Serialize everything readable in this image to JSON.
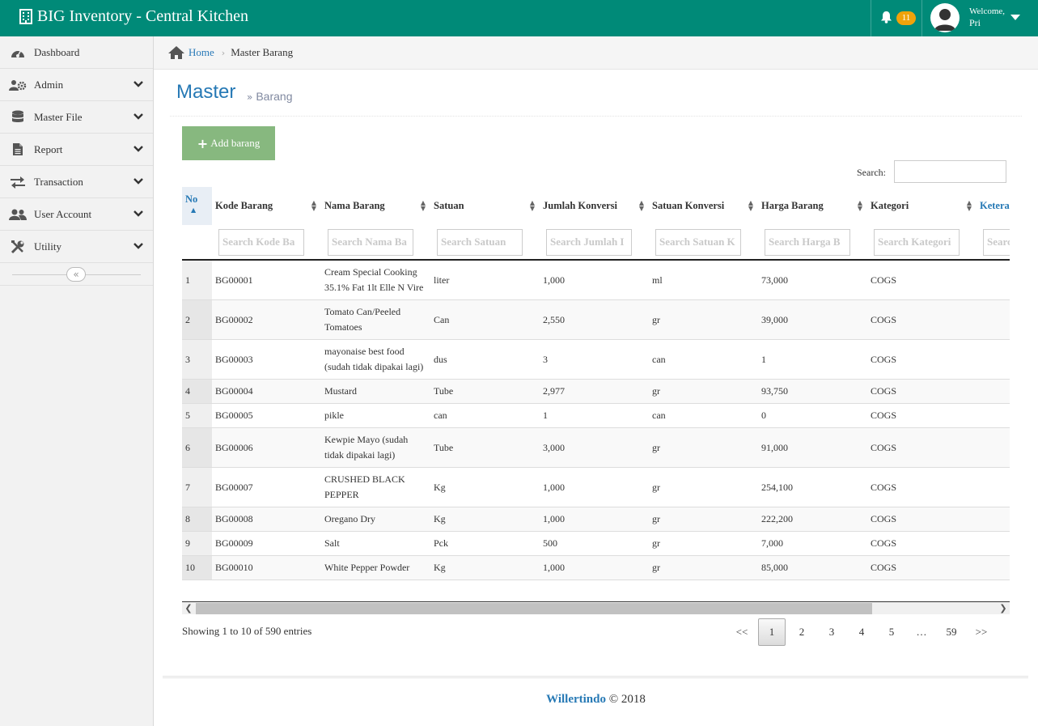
{
  "app": {
    "title": "BIG Inventory - Central Kitchen",
    "notifications": "11",
    "welcome": "Welcome,",
    "username": "Pri",
    "accent": "#008a78"
  },
  "sidebar": {
    "items": [
      {
        "label": "Dashboard",
        "icon": "dashboard-icon"
      },
      {
        "label": "Admin",
        "icon": "users-gear-icon"
      },
      {
        "label": "Master File",
        "icon": "database-icon"
      },
      {
        "label": "Report",
        "icon": "file-icon"
      },
      {
        "label": "Transaction",
        "icon": "exchange-icon"
      },
      {
        "label": "User Account",
        "icon": "users-icon"
      },
      {
        "label": "Utility",
        "icon": "tools-icon"
      }
    ],
    "collapse": "«"
  },
  "breadcrumb": {
    "home": "Home",
    "current": "Master Barang"
  },
  "page": {
    "title": "Master",
    "subtitle": "Barang",
    "add_button": "Add barang",
    "search_label": "Search:"
  },
  "table": {
    "columns": [
      "No",
      "Kode Barang",
      "Nama Barang",
      "Satuan",
      "Jumlah Konversi",
      "Satuan Konversi",
      "Harga Barang",
      "Kategori",
      "Ketera"
    ],
    "filters": [
      "Search Kode Ba",
      "Search Nama Ba",
      "Search Satuan",
      "Search Jumlah I",
      "Search Satuan K",
      "Search Harga B",
      "Search Kategori",
      "Searc"
    ],
    "rows": [
      [
        "1",
        "BG00001",
        "Cream Special Cooking 35.1% Fat 1lt Elle N Vire",
        "liter",
        "1,000",
        "ml",
        "73,000",
        "COGS",
        ""
      ],
      [
        "2",
        "BG00002",
        "Tomato Can/Peeled Tomatoes",
        "Can",
        "2,550",
        "gr",
        "39,000",
        "COGS",
        ""
      ],
      [
        "3",
        "BG00003",
        "mayonaise best food (sudah tidak dipakai lagi)",
        "dus",
        "3",
        "can",
        "1",
        "COGS",
        ""
      ],
      [
        "4",
        "BG00004",
        "Mustard",
        "Tube",
        "2,977",
        "gr",
        "93,750",
        "COGS",
        ""
      ],
      [
        "5",
        "BG00005",
        "pikle",
        "can",
        "1",
        "can",
        "0",
        "COGS",
        ""
      ],
      [
        "6",
        "BG00006",
        "Kewpie Mayo (sudah tidak dipakai lagi)",
        "Tube",
        "3,000",
        "gr",
        "91,000",
        "COGS",
        ""
      ],
      [
        "7",
        "BG00007",
        "CRUSHED BLACK PEPPER",
        "Kg",
        "1,000",
        "gr",
        "254,100",
        "COGS",
        ""
      ],
      [
        "8",
        "BG00008",
        "Oregano Dry",
        "Kg",
        "1,000",
        "gr",
        "222,200",
        "COGS",
        ""
      ],
      [
        "9",
        "BG00009",
        "Salt",
        "Pck",
        "500",
        "gr",
        "7,000",
        "COGS",
        ""
      ],
      [
        "10",
        "BG00010",
        "White Pepper Powder",
        "Kg",
        "1,000",
        "gr",
        "85,000",
        "COGS",
        ""
      ]
    ]
  },
  "info": "Showing 1 to 10 of 590 entries",
  "pagination": [
    "<<",
    "1",
    "2",
    "3",
    "4",
    "5",
    "…",
    "59",
    ">>"
  ],
  "pagination_active": "1",
  "footer": {
    "brand": "Willertindo",
    "copyright": "© 2018"
  }
}
